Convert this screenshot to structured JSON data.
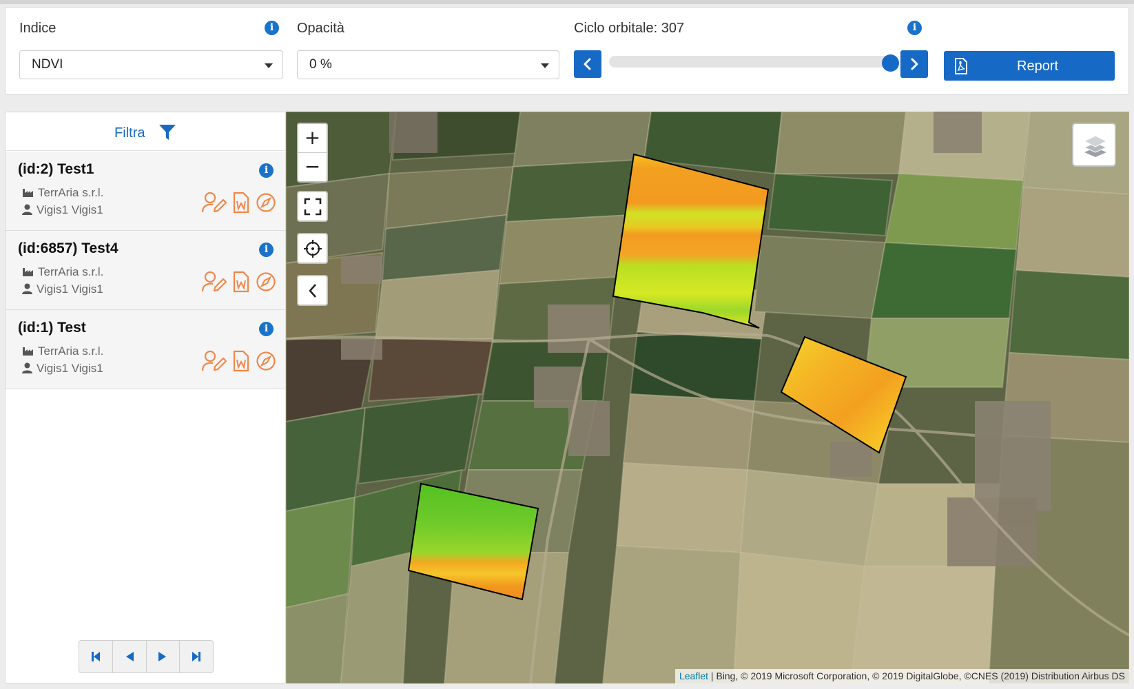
{
  "toolbar": {
    "indice_label": "Indice",
    "indice_value": "NDVI",
    "opacita_label": "Opacità",
    "opacita_value": "0 %",
    "ciclo_label": "Ciclo orbitale: 307",
    "slider_position_fraction": 0.97,
    "report_label": "Report",
    "accent_color": "#1769c6"
  },
  "sidebar": {
    "filter_label": "Filtra",
    "items": [
      {
        "title": "(id:2) Test1",
        "company": "TerrAria s.r.l.",
        "user": "Vigis1 Vigis1"
      },
      {
        "title": "(id:6857) Test4",
        "company": "TerrAria s.r.l.",
        "user": "Vigis1 Vigis1"
      },
      {
        "title": "(id:1) Test",
        "company": "TerrAria s.r.l.",
        "user": "Vigis1 Vigis1"
      }
    ],
    "action_color": "#f0874a"
  },
  "map": {
    "zoom_in": "+",
    "zoom_out": "−",
    "attribution_link": "Leaflet",
    "attribution_text": " | Bing, © 2019 Microsoft Corporation, © 2019 DigitalGlobe, ©CNES (2019) Distribution Airbus DS"
  }
}
